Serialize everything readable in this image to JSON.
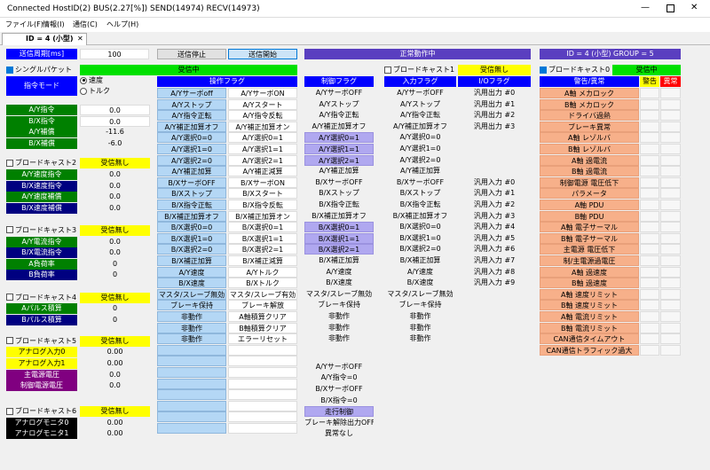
{
  "title": {
    "text": "Connected  HostID(2)  BUS(2.27[%])  SEND(14974)  RECV(14973)"
  },
  "menu": [
    "ファイル(F)",
    "情報(I)",
    "通信(C)",
    "ヘルプ(H)"
  ],
  "tab": {
    "label": "ID = 4 (小型)",
    "close": "✕"
  },
  "top": {
    "period_label": "送信周期[ms]",
    "period_value": "100",
    "stop_label": "送信停止",
    "start_label": "送信開始",
    "status": "正常動作中",
    "id_group": "ID = 4 (小型)  GROUP = 5"
  },
  "left": {
    "single_label": "シングルパケット",
    "mode_label": "指令モード",
    "radio_speed": "速度",
    "radio_torque": "トルク",
    "g1": [
      {
        "label": "A/Y指令",
        "value": "0.0"
      },
      {
        "label": "B/X指令",
        "value": "0.0"
      },
      {
        "label": "A/Y補償",
        "value": "-11.6"
      },
      {
        "label": "B/X補償",
        "value": "-6.0"
      }
    ],
    "bc2": {
      "label": "ブロードキャスト2",
      "status": "受信無し"
    },
    "g2": [
      {
        "label": "A/Y速度指令",
        "value": "0.0"
      },
      {
        "label": "B/X速度指令",
        "value": "0.0"
      },
      {
        "label": "A/Y速度補償",
        "value": "0.0"
      },
      {
        "label": "B/X速度補償",
        "value": "0.0"
      }
    ],
    "bc3": {
      "label": "ブロードキャスト3",
      "status": "受信無し"
    },
    "g3": [
      {
        "label": "A/Y電流指令",
        "value": "0.0"
      },
      {
        "label": "B/X電流指令",
        "value": "0.0"
      },
      {
        "label": "A負荷率",
        "value": "0"
      },
      {
        "label": "B負荷率",
        "value": "0"
      }
    ],
    "bc4": {
      "label": "ブロードキャスト4",
      "status": "受信無し"
    },
    "g4": [
      {
        "label": "Aパルス積算",
        "value": "0"
      },
      {
        "label": "Bパルス積算",
        "value": "0"
      }
    ],
    "bc5": {
      "label": "ブロードキャスト5",
      "status": "受信無し"
    },
    "g5": [
      {
        "label": "アナログ入力0",
        "value": "0.00"
      },
      {
        "label": "アナログ入力1",
        "value": "0.00"
      },
      {
        "label": "主電源電圧",
        "value": "0.0"
      },
      {
        "label": "制御電源電圧",
        "value": "0.0"
      }
    ],
    "bc6": {
      "label": "ブロードキャスト6",
      "status": "受信無し"
    },
    "g6": [
      {
        "label": "アナログモニタ0",
        "value": "0.00"
      },
      {
        "label": "アナログモニタ1",
        "value": "0.00"
      }
    ]
  },
  "op": {
    "receiving": "受信中",
    "header": "操作フラグ",
    "rows": [
      [
        "A/Yサーボoff",
        "A/YサーボON"
      ],
      [
        "A/Yストップ",
        "A/Yスタート"
      ],
      [
        "A/Y指令正転",
        "A/Y指令反転"
      ],
      [
        "A/Y補正加算オフ",
        "A/Y補正加算オン"
      ],
      [
        "A/Y選択0=0",
        "A/Y選択0=1"
      ],
      [
        "A/Y選択1=0",
        "A/Y選択1=1"
      ],
      [
        "A/Y選択2=0",
        "A/Y選択2=1"
      ],
      [
        "A/Y補正加算",
        "A/Y補正減算"
      ],
      [
        "B/XサーボOFF",
        "B/XサーボON"
      ],
      [
        "B/Xストップ",
        "B/Xスタート"
      ],
      [
        "B/X指令正転",
        "B/X指令反転"
      ],
      [
        "B/X補正加算オフ",
        "B/X補正加算オン"
      ],
      [
        "B/X選択0=0",
        "B/X選択0=1"
      ],
      [
        "B/X選択1=0",
        "B/X選択1=1"
      ],
      [
        "B/X選択2=0",
        "B/X選択2=1"
      ],
      [
        "B/X補正加算",
        "B/X補正減算"
      ],
      [
        "A/Y速度",
        "A/Yトルク"
      ],
      [
        "B/X速度",
        "B/Xトルク"
      ],
      [
        "マスタ/スレーブ無効",
        "マスタ/スレーブ有効"
      ],
      [
        "ブレーキ保持",
        "ブレーキ解放"
      ],
      [
        "非動作",
        "A軸積算クリア"
      ],
      [
        "非動作",
        "B軸積算クリア"
      ],
      [
        "非動作",
        "エラーリセット"
      ]
    ],
    "empty_count": 8
  },
  "ctrl": {
    "header": "制御フラグ",
    "rows": [
      {
        "t": "A/YサーボOFF",
        "h": false
      },
      {
        "t": "A/Yストップ",
        "h": false
      },
      {
        "t": "A/Y指令正転",
        "h": false
      },
      {
        "t": "A/Y補正加算オフ",
        "h": false
      },
      {
        "t": "A/Y選択0=1",
        "h": true
      },
      {
        "t": "A/Y選択1=1",
        "h": true
      },
      {
        "t": "A/Y選択2=1",
        "h": true
      },
      {
        "t": "A/Y補正加算",
        "h": false
      },
      {
        "t": "B/XサーボOFF",
        "h": false
      },
      {
        "t": "B/Xストップ",
        "h": false
      },
      {
        "t": "B/X指令正転",
        "h": false
      },
      {
        "t": "B/X補正加算オフ",
        "h": false
      },
      {
        "t": "B/X選択0=1",
        "h": true
      },
      {
        "t": "B/X選択1=1",
        "h": true
      },
      {
        "t": "B/X選択2=1",
        "h": true
      },
      {
        "t": "B/X補正加算",
        "h": false
      },
      {
        "t": "A/Y速度",
        "h": false
      },
      {
        "t": "B/X速度",
        "h": false
      },
      {
        "t": "マスタ/スレーブ無効",
        "h": false
      },
      {
        "t": "ブレーキ保持",
        "h": false
      },
      {
        "t": "非動作",
        "h": false
      },
      {
        "t": "非動作",
        "h": false
      },
      {
        "t": "非動作",
        "h": false
      }
    ],
    "extra": [
      {
        "t": "A/YサーボOFF",
        "h": false
      },
      {
        "t": "A/Y指令=0",
        "h": false
      },
      {
        "t": "B/XサーボOFF",
        "h": false
      },
      {
        "t": "B/X指令=0",
        "h": false
      },
      {
        "t": "走行制御",
        "h": true
      },
      {
        "t": "ブレーキ解除出力OFF",
        "h": false
      },
      {
        "t": "異常なし",
        "h": false
      }
    ]
  },
  "bc1": {
    "label": "ブロードキャスト1",
    "status": "受信無し",
    "in_header": "入力フラグ",
    "io_header": "I/Oフラグ",
    "in_rows": [
      "A/YサーボOFF",
      "A/Yストップ",
      "A/Y指令正転",
      "A/Y補正加算オフ",
      "A/Y選択0=0",
      "A/Y選択1=0",
      "A/Y選択2=0",
      "A/Y補正加算",
      "B/XサーボOFF",
      "B/Xストップ",
      "B/X指令正転",
      "B/X補正加算オフ",
      "B/X選択0=0",
      "B/X選択1=0",
      "B/X選択2=0",
      "B/X補正加算",
      "A/Y速度",
      "B/X速度",
      "マスタ/スレーブ無効",
      "ブレーキ保持",
      "非動作",
      "非動作",
      "非動作"
    ],
    "io_rows": [
      "汎用出力 #0",
      "汎用出力 #1",
      "汎用出力 #2",
      "汎用出力 #3",
      "",
      "",
      "",
      "",
      "汎用入力 #0",
      "汎用入力 #1",
      "汎用入力 #2",
      "汎用入力 #3",
      "汎用入力 #4",
      "汎用入力 #5",
      "汎用入力 #6",
      "汎用入力 #7",
      "汎用入力 #8",
      "汎用入力 #9"
    ]
  },
  "bc0": {
    "label": "ブロードキャスト0",
    "status": "受信中",
    "header": "警告/異常",
    "warn": "警告",
    "err": "異常",
    "rows": [
      "A軸 メカロック",
      "B軸 メカロック",
      "ドライバ過熱",
      "ブレーキ異常",
      "A軸 レゾルバ",
      "B軸 レゾルバ",
      "A軸 過電流",
      "B軸 過電流",
      "制御電源 電圧低下",
      "パラメータ",
      "A軸 PDU",
      "B軸 PDU",
      "A軸 電子サーマル",
      "B軸 電子サーマル",
      "主電源 電圧低下",
      "制/主電源過電圧",
      "A軸 過速度",
      "B軸 過速度",
      "A軸 速度リミット",
      "B軸 速度リミット",
      "A軸 電流リミット",
      "B軸 電流リミット",
      "CAN通信タイムアウト",
      "CAN通信トラフィック過大"
    ]
  }
}
